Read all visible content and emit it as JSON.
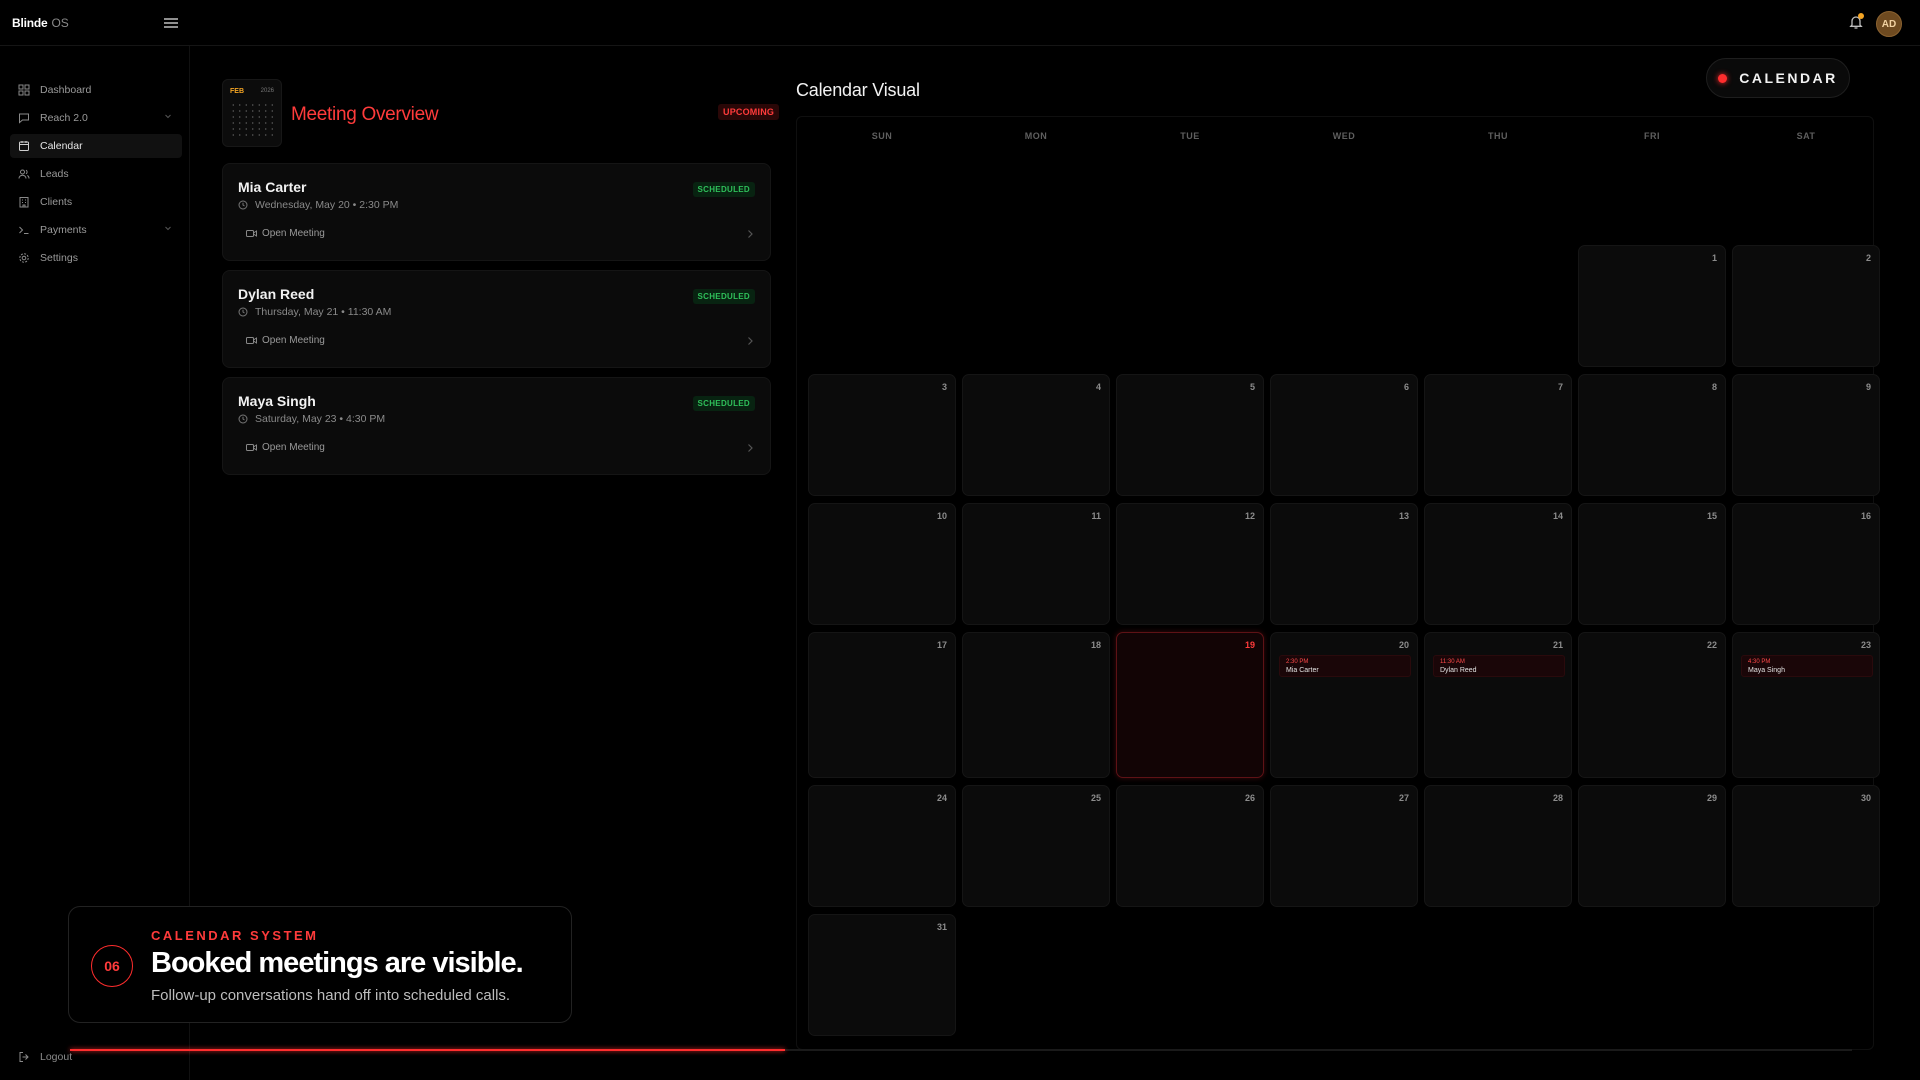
{
  "app": {
    "name": "Blinde",
    "suffix": "OS"
  },
  "header": {
    "user_initials": "AD"
  },
  "sidebar": {
    "items": [
      {
        "label": "Dashboard",
        "icon": "grid-icon"
      },
      {
        "label": "Reach 2.0",
        "icon": "message-icon"
      },
      {
        "label": "Calendar",
        "icon": "calendar-icon",
        "active": true
      },
      {
        "label": "Leads",
        "icon": "users-icon"
      },
      {
        "label": "Clients",
        "icon": "building-icon"
      },
      {
        "label": "Payments",
        "icon": "terminal-icon"
      },
      {
        "label": "Settings",
        "icon": "gear-icon"
      }
    ],
    "logout": "Logout"
  },
  "overview": {
    "mini_month": "FEB",
    "mini_year": "2026",
    "title": "Meeting Overview",
    "badge": "UPCOMING",
    "meetings": [
      {
        "name": "Mia Carter",
        "when": "Wednesday, May 20 • 2:30 PM",
        "status": "SCHEDULED",
        "action": "Open Meeting"
      },
      {
        "name": "Dylan Reed",
        "when": "Thursday, May 21 • 11:30 AM",
        "status": "SCHEDULED",
        "action": "Open Meeting"
      },
      {
        "name": "Maya Singh",
        "when": "Saturday, May 23 • 4:30 PM",
        "status": "SCHEDULED",
        "action": "Open Meeting"
      }
    ]
  },
  "calendar": {
    "title": "Calendar Visual",
    "button_label": "CALENDAR",
    "weekdays": [
      "SUN",
      "MON",
      "TUE",
      "WED",
      "THU",
      "FRI",
      "SAT"
    ],
    "days": [
      "1",
      "2",
      "3",
      "4",
      "5",
      "6",
      "7",
      "8",
      "9",
      "10",
      "11",
      "12",
      "13",
      "14",
      "15",
      "16",
      "17",
      "18",
      "19",
      "20",
      "21",
      "22",
      "23",
      "24",
      "25",
      "26",
      "27",
      "28",
      "29",
      "30",
      "31"
    ],
    "today": "19",
    "events": [
      {
        "day": "20",
        "time": "2:30 PM",
        "name": "Mia Carter"
      },
      {
        "day": "21",
        "time": "11:30 AM",
        "name": "Dylan Reed"
      },
      {
        "day": "23",
        "time": "4:30 PM",
        "name": "Maya Singh"
      }
    ]
  },
  "overlay": {
    "step": "06",
    "kicker": "CALENDAR SYSTEM",
    "title": "Booked meetings are visible.",
    "subtitle": "Follow-up conversations hand off into scheduled calls."
  },
  "progress": {
    "value": 0.401
  },
  "colors": {
    "accent": "#ff2d2d",
    "success": "#2fbf5a",
    "warning": "#f5a524",
    "background": "#000000"
  }
}
